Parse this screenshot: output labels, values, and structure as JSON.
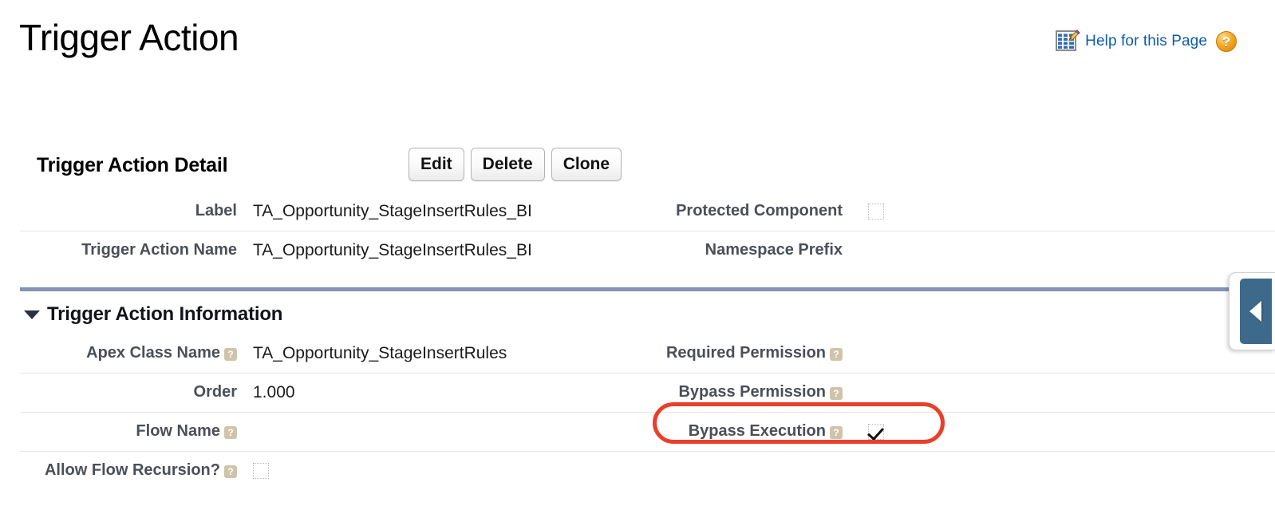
{
  "header": {
    "page_title": "Trigger Action",
    "help_link": "Help for this Page",
    "help_doc_icon": "page-edit-icon",
    "question_mark": "?",
    "question_icon": "help-question-icon"
  },
  "detail": {
    "section_label": "Trigger Action Detail",
    "buttons": [
      {
        "label": "Edit",
        "name": "edit-button"
      },
      {
        "label": "Delete",
        "name": "delete-button"
      },
      {
        "label": "Clone",
        "name": "clone-button"
      }
    ]
  },
  "top_fields": [
    {
      "left_label": "Label",
      "left_value": "TA_Opportunity_StageInsertRules_BI",
      "left_help": false,
      "right_label": "Protected Component",
      "right_help": false,
      "right_value": "",
      "right_checkbox": "unchecked"
    },
    {
      "left_label": "Trigger Action Name",
      "left_value": "TA_Opportunity_StageInsertRules_BI",
      "left_help": false,
      "right_label": "Namespace Prefix",
      "right_help": false,
      "right_value": "",
      "right_checkbox": null
    }
  ],
  "information_section": {
    "title": "Trigger Action Information",
    "caret_icon": "triangle-down-icon",
    "collapsed": false
  },
  "info_fields": [
    {
      "left_label": "Apex Class Name",
      "left_help": true,
      "left_value": "TA_Opportunity_StageInsertRules",
      "left_checkbox": null,
      "right_label": "Required Permission",
      "right_help": true,
      "right_value": "",
      "right_checkbox": null,
      "highlighted": false
    },
    {
      "left_label": "Order",
      "left_help": false,
      "left_value": "1.000",
      "left_checkbox": null,
      "right_label": "Bypass Permission",
      "right_help": true,
      "right_value": "",
      "right_checkbox": null,
      "highlighted": false
    },
    {
      "left_label": "Flow Name",
      "left_help": true,
      "left_value": "",
      "left_checkbox": null,
      "right_label": "Bypass Execution",
      "right_help": true,
      "right_value": "",
      "right_checkbox": "checked",
      "highlighted": true
    },
    {
      "left_label": "Allow Flow Recursion?",
      "left_help": true,
      "left_value": "",
      "left_checkbox": "unchecked",
      "right_label": "",
      "right_help": false,
      "right_value": "",
      "right_checkbox": null,
      "highlighted": false
    }
  ],
  "side_tab": {
    "icon": "chevron-left-icon",
    "color": "#3d6a8a"
  },
  "annotation": {
    "type": "ellipse-highlight",
    "color": "#e8402a",
    "target": "Bypass Execution"
  },
  "help_dot_glyph": "?"
}
